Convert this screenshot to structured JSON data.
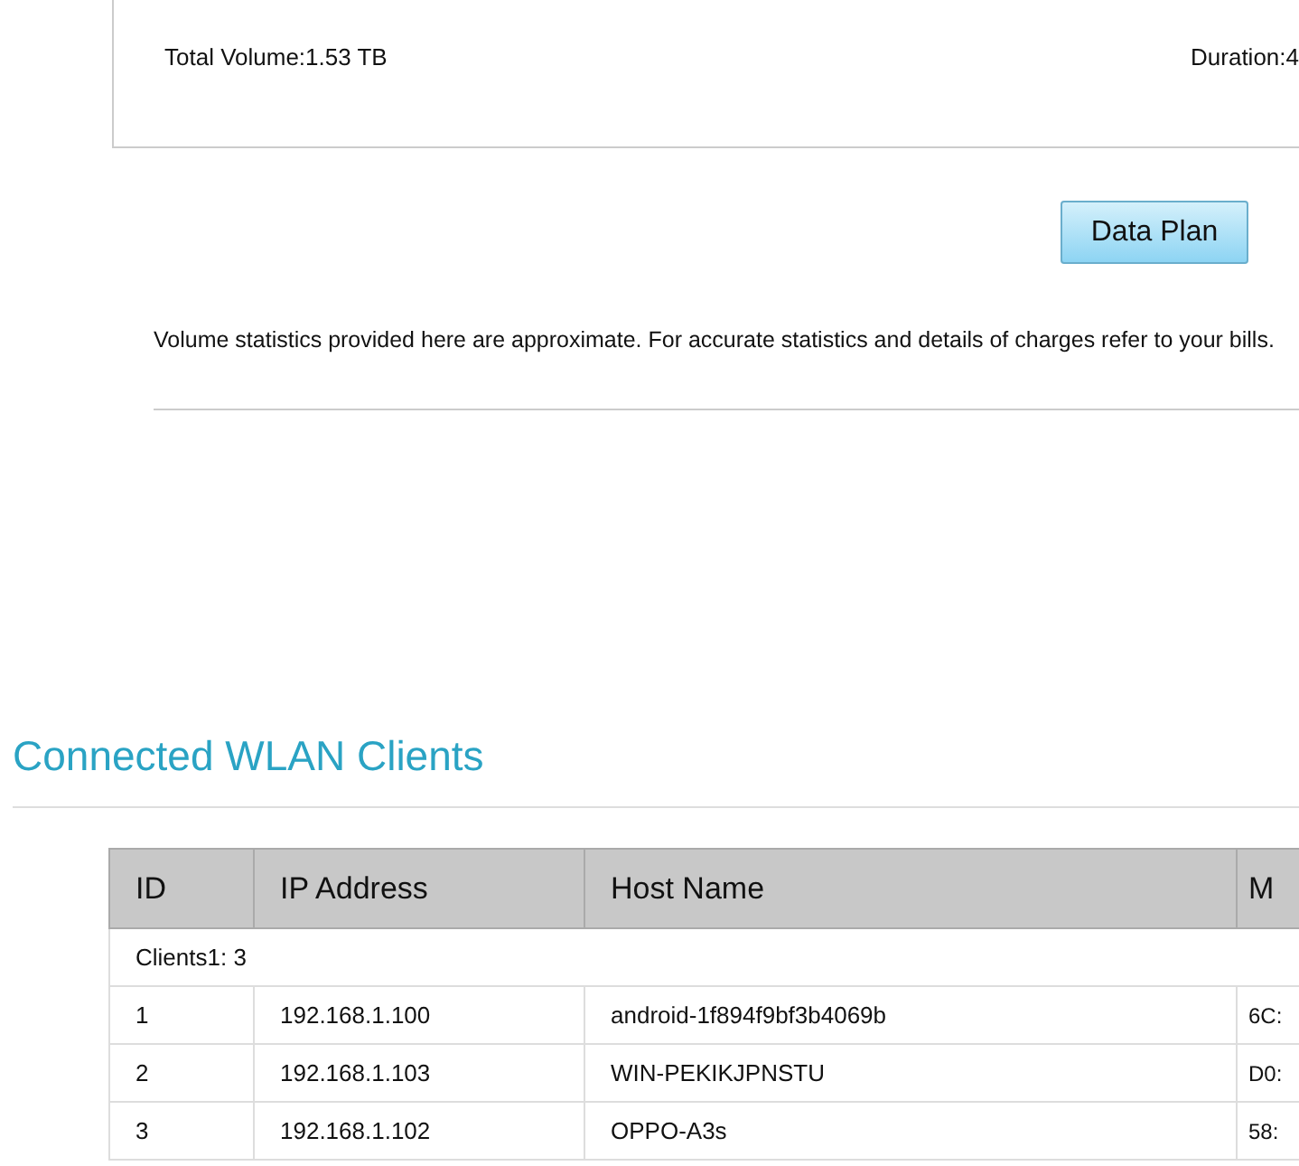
{
  "summary": {
    "total_volume": "Total Volume:1.53 TB",
    "duration": "Duration:4"
  },
  "data_plan_button": "Data Plan",
  "note": "Volume statistics provided here are approximate. For accurate statistics and details of charges refer to your bills.",
  "wlan_clients": {
    "title": "Connected WLAN Clients",
    "table": {
      "columns": [
        "ID",
        "IP Address",
        "Host Name",
        "M"
      ],
      "group_label": "Clients1: 3",
      "rows": [
        [
          "1",
          "192.168.1.100",
          "android-1f894f9bf3b4069b",
          "6C:"
        ],
        [
          "2",
          "192.168.1.103",
          "WIN-PEKIKJPNSTU",
          "D0:"
        ],
        [
          "3",
          "192.168.1.102",
          "OPPO-A3s",
          "58:"
        ]
      ]
    }
  }
}
